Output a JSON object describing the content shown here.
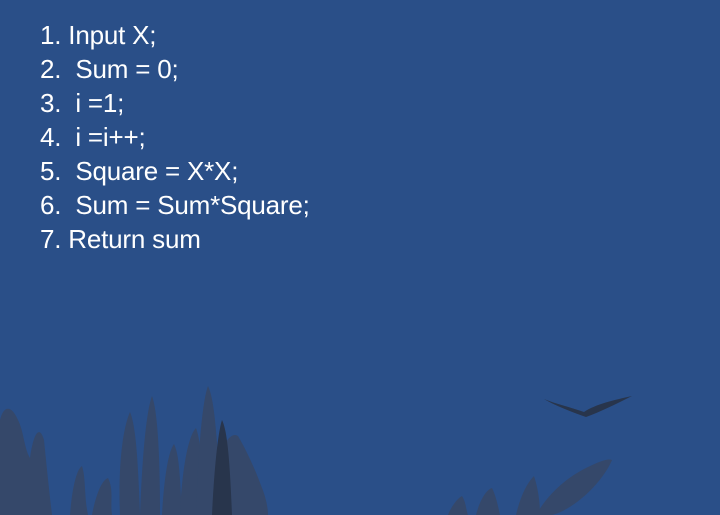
{
  "slide": {
    "lines": [
      "1. Input X;",
      "2.  Sum = 0;",
      "3.  i =1;",
      "4.  i =i++;",
      "5.  Square = X*X;",
      "6.  Sum = Sum*Square;",
      "7. Return sum"
    ]
  },
  "colors": {
    "background": "#2a4f88",
    "text": "#ffffff",
    "silhouette_light": "#35486a",
    "silhouette_dark": "#28354c"
  },
  "decorations": {
    "left": "seaweed-silhouette",
    "right": "plant-silhouette",
    "bird": "flying-bird-silhouette"
  }
}
